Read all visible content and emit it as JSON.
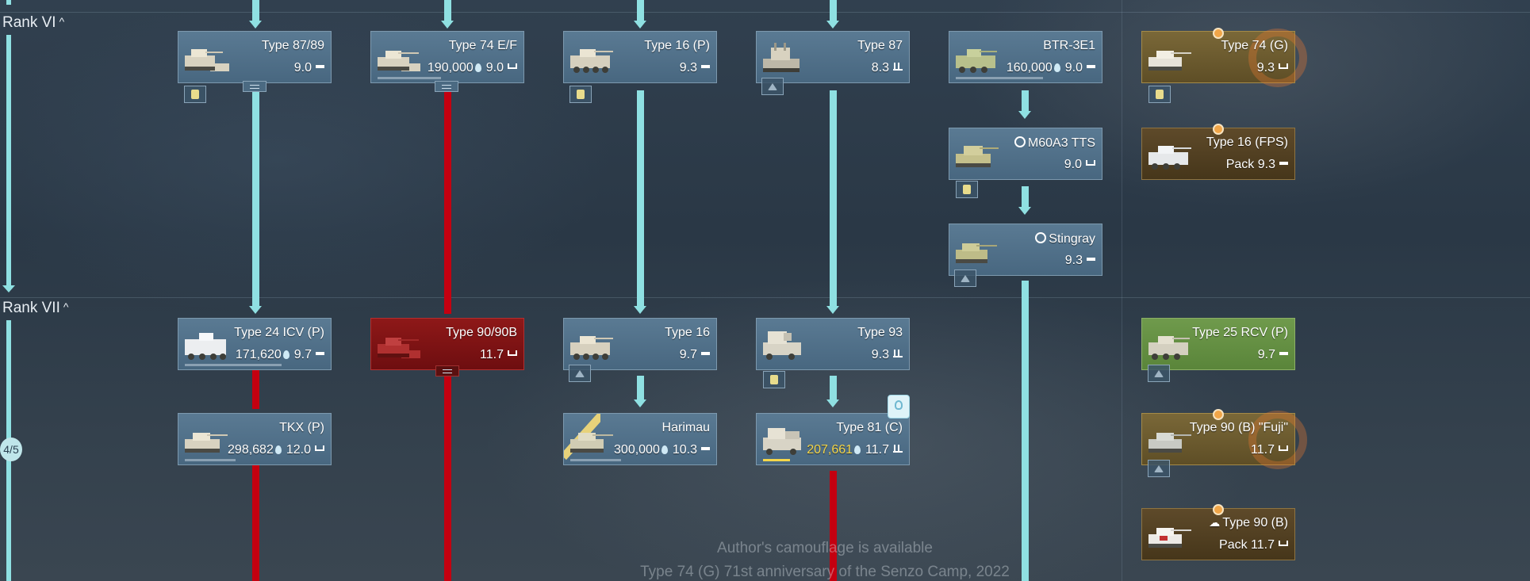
{
  "ranks": {
    "vi_label": "Rank VI",
    "vii_label": "Rank VII",
    "chevron": "^",
    "progress_badge": "4/5"
  },
  "vehicles": {
    "type87_89": {
      "name": "Type 87/89",
      "br": "9.0",
      "class": "light-tank-icon"
    },
    "type74ef": {
      "name": "Type 74 E/F",
      "cost": "190,000",
      "br": "9.0",
      "class": "medium-tank-icon"
    },
    "type16p": {
      "name": "Type 16 (P)",
      "br": "9.3",
      "class": "light-tank-icon"
    },
    "type87": {
      "name": "Type 87",
      "br": "8.3",
      "class": "spaa-icon"
    },
    "btr3e1": {
      "name": "BTR-3E1",
      "cost": "160,000",
      "br": "9.0",
      "class": "light-tank-icon"
    },
    "type74g": {
      "name": "Type 74 (G)",
      "br": "9.3",
      "class": "medium-tank-icon"
    },
    "m60a3tts": {
      "name": "M60A3 TTS",
      "br": "9.0",
      "class": "medium-tank-icon"
    },
    "type16fps": {
      "name": "Type 16 (FPS)",
      "prefix": "Pack",
      "br": "9.3",
      "class": "light-tank-icon"
    },
    "stingray": {
      "name": "Stingray",
      "br": "9.3",
      "class": "light-tank-icon"
    },
    "type24icv": {
      "name": "Type 24 ICV (P)",
      "cost": "171,620",
      "br": "9.7",
      "class": "light-tank-icon"
    },
    "type90_90b": {
      "name": "Type 90/90B",
      "br": "11.7",
      "class": "medium-tank-icon"
    },
    "type16": {
      "name": "Type 16",
      "br": "9.7",
      "class": "light-tank-icon"
    },
    "type93": {
      "name": "Type 93",
      "br": "9.3",
      "class": "spaa-icon"
    },
    "type25rcv": {
      "name": "Type 25 RCV (P)",
      "br": "9.7",
      "class": "light-tank-icon"
    },
    "tkx": {
      "name": "TKX (P)",
      "cost": "298,682",
      "br": "12.0",
      "class": "medium-tank-icon"
    },
    "harimau": {
      "name": "Harimau",
      "cost": "300,000",
      "br": "10.3",
      "class": "light-tank-icon"
    },
    "type81c": {
      "name": "Type 81 (C)",
      "cost": "207,661",
      "br": "11.7",
      "class": "spaa-icon"
    },
    "type90b_fuji": {
      "name": "Type 90 (B) \"Fuji\"",
      "br": "11.7",
      "class": "medium-tank-icon"
    },
    "type90b": {
      "name": "Type 90 (B)",
      "prefix": "Pack",
      "br": "11.7",
      "class": "medium-tank-icon"
    }
  },
  "camo_notice": {
    "line1": "Author's camouflage is available",
    "line2": "Type 74 (G) 71st anniversary of the Senzo Camp, 2022"
  },
  "colors": {
    "researched_pipe": "#8fe0e2",
    "locked_pipe": "#c40010",
    "premium_card": "#7a6838",
    "squadron_card": "#8e1818",
    "event_card": "#6f9a4c"
  }
}
